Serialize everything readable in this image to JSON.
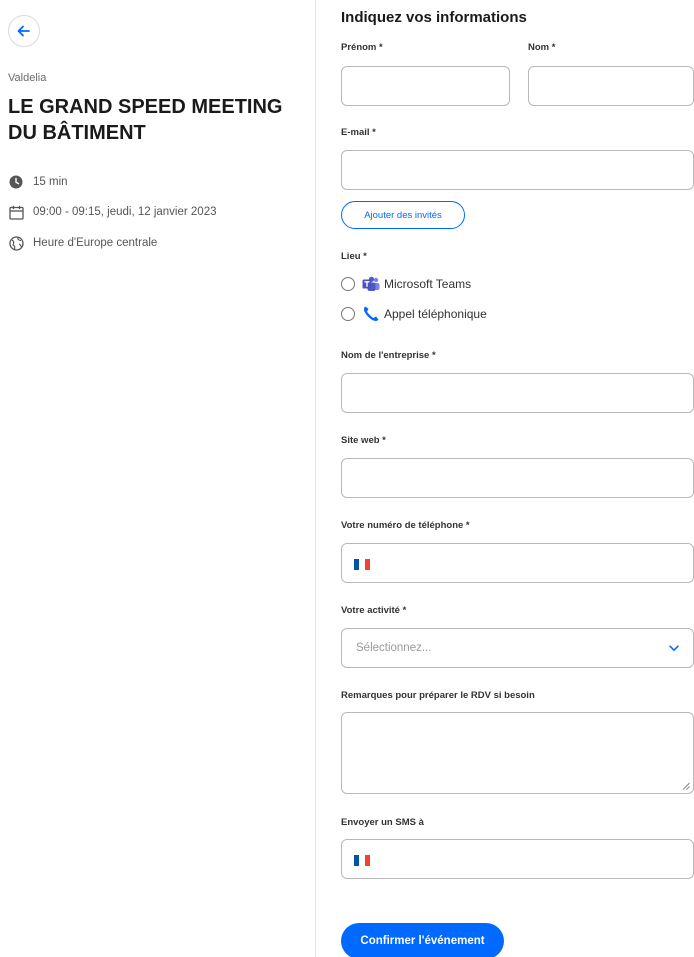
{
  "event": {
    "organizer": "Valdelia",
    "title": "LE GRAND SPEED MEETING DU BÂTIMENT",
    "duration": "15 min",
    "datetime": "09:00 - 09:15, jeudi, 12 janvier 2023",
    "timezone": "Heure d'Europe centrale"
  },
  "form": {
    "title": "Indiquez vos informations",
    "first_name_label": "Prénom *",
    "last_name_label": "Nom *",
    "email_label": "E-mail *",
    "add_guests": "Ajouter des invités",
    "location_label": "Lieu *",
    "location_options": [
      "Microsoft Teams",
      "Appel téléphonique"
    ],
    "company_label": "Nom de l'entreprise *",
    "website_label": "Site web *",
    "phone_label": "Votre numéro de téléphone *",
    "activity_label": "Votre activité *",
    "activity_placeholder": "Sélectionnez...",
    "notes_label": "Remarques pour préparer le RDV si besoin",
    "sms_label": "Envoyer un SMS à",
    "confirm_button": "Confirmer l'événement"
  },
  "colors": {
    "accent": "#0069ff",
    "teams": "#5059c9",
    "flag_blue": "#0055a4",
    "flag_red": "#ef4135"
  },
  "icons": [
    "back-arrow-icon",
    "clock-icon",
    "calendar-icon",
    "globe-icon",
    "teams-icon",
    "phone-icon",
    "chevron-down-icon"
  ]
}
